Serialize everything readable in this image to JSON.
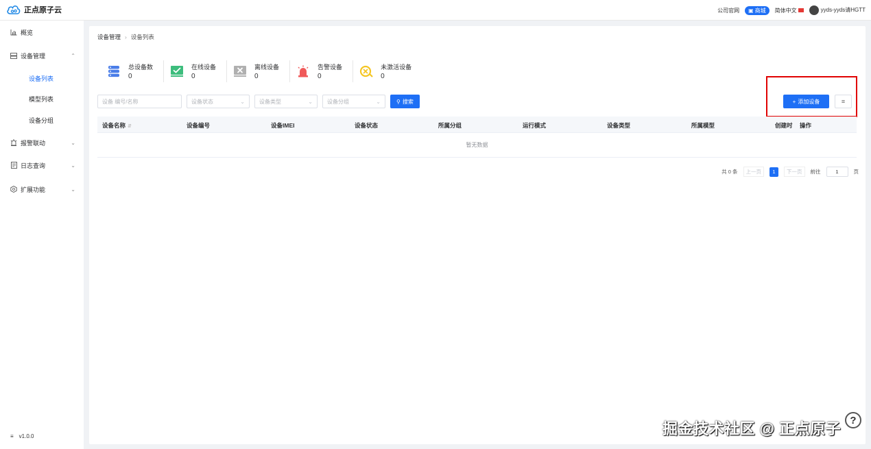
{
  "header": {
    "brand": "正点原子云",
    "links": {
      "official_site": "公司官网",
      "shop": "商城",
      "language": "简体中文",
      "username": "yyds-yyds请HGTT"
    }
  },
  "sidebar": {
    "items": [
      {
        "label": "概览",
        "icon": "bar-chart-icon"
      },
      {
        "label": "设备管理",
        "icon": "server-icon",
        "expanded": true
      },
      {
        "label": "设备列表",
        "sub": true,
        "active": true
      },
      {
        "label": "模型列表",
        "sub": true
      },
      {
        "label": "设备分组",
        "sub": true
      },
      {
        "label": "报警联动",
        "icon": "alarm-icon"
      },
      {
        "label": "日志查询",
        "icon": "log-icon"
      },
      {
        "label": "扩展功能",
        "icon": "extension-icon"
      }
    ],
    "version": "v1.0.0"
  },
  "breadcrumb": {
    "parent": "设备管理",
    "current": "设备列表"
  },
  "stats": [
    {
      "label": "总设备数",
      "value": "0",
      "icon": "total-devices-icon",
      "color": "#4a7de8"
    },
    {
      "label": "在线设备",
      "value": "0",
      "icon": "online-devices-icon",
      "color": "#3dbd7d"
    },
    {
      "label": "离线设备",
      "value": "0",
      "icon": "offline-devices-icon",
      "color": "#9e9e9e"
    },
    {
      "label": "告警设备",
      "value": "0",
      "icon": "alarm-devices-icon",
      "color": "#f05a5a"
    },
    {
      "label": "未激活设备",
      "value": "0",
      "icon": "inactive-devices-icon",
      "color": "#f5c623"
    }
  ],
  "filters": {
    "device_input_placeholder": "设备 编号/名称",
    "status_placeholder": "设备状态",
    "type_placeholder": "设备类型",
    "group_placeholder": "设备分组",
    "search_label": "搜索"
  },
  "actions": {
    "add_device": "添加设备"
  },
  "table": {
    "columns": [
      "设备名称",
      "设备编号",
      "设备IMEI",
      "设备状态",
      "所属分组",
      "运行模式",
      "设备类型",
      "所属模型",
      "创建时",
      "操作"
    ],
    "empty_text": "暂无数据"
  },
  "pagination": {
    "total": "共 0 条",
    "prev": "上一页",
    "page": "1",
    "next": "下一页",
    "goto": "前往",
    "goto_value": "1",
    "page_suffix": "页"
  },
  "watermark": "掘金技术社区 @ 正点原子",
  "help": "?"
}
